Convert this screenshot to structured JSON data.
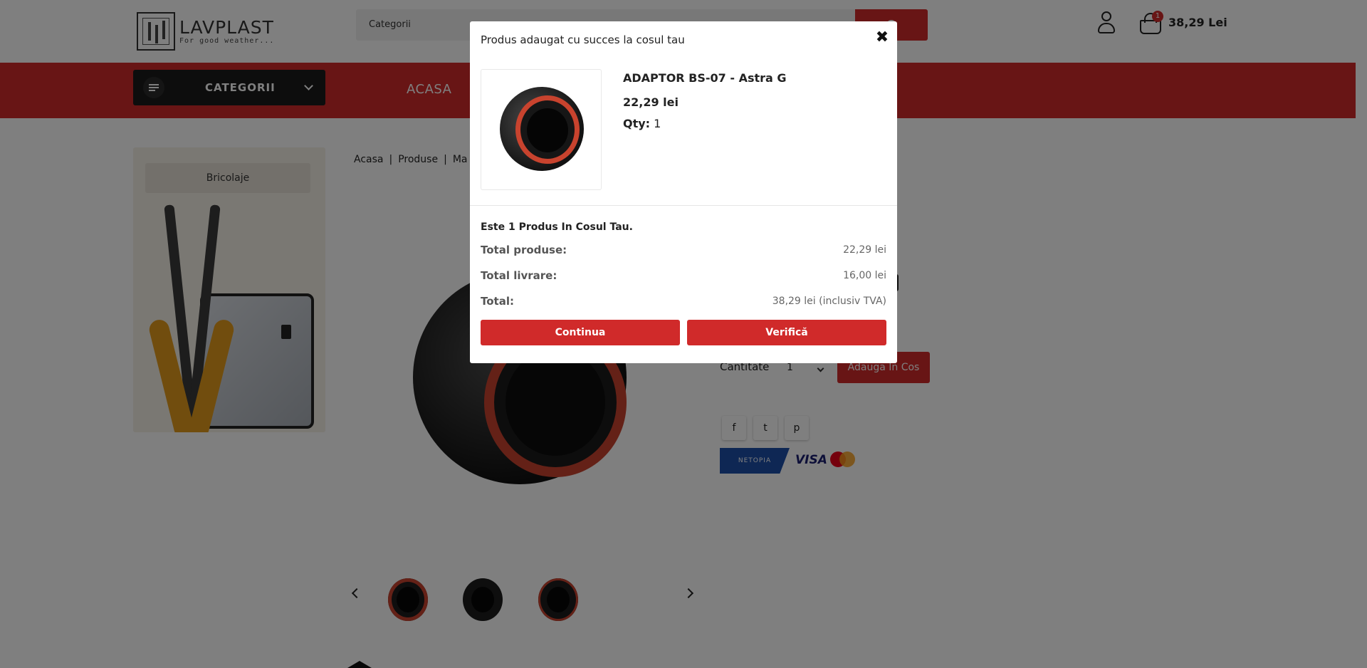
{
  "header": {
    "logo_name": "LAVPLAST",
    "logo_tagline": "For good weather...",
    "search_category": "Categorii",
    "cart_count": "1",
    "cart_total": "38,29 Lei"
  },
  "nav": {
    "categories_label": "CATEGORII",
    "home_link": "ACASA"
  },
  "sidebar": {
    "banner_label": "Bricolaje"
  },
  "breadcrumb": [
    "Acasa",
    "Produse",
    "Ma"
  ],
  "product": {
    "title_visible_tail": "G",
    "quantity_label": "Cantitate",
    "quantity_value": "1",
    "add_to_cart_label": "Adauga In Cos"
  },
  "social": {
    "facebook_icon": "f",
    "twitter_icon": "t",
    "pinterest_icon": "p"
  },
  "payments": {
    "netopia": "NETOPIA PAYMENTS",
    "visa": "VISA"
  },
  "modal": {
    "title": "Produs adaugat cu succes la cosul tau",
    "close_glyph": "✖",
    "product_name": "ADAPTOR BS-07 - Astra G",
    "product_price": "22,29 lei",
    "qty_label": "Qty:",
    "qty_value": "1",
    "cart_count_text": "Este 1 Produs In Cosul Tau.",
    "summary": [
      {
        "label": "Total produse:",
        "value": "22,29 lei"
      },
      {
        "label": "Total livrare:",
        "value": "16,00 lei"
      },
      {
        "label": "Total:",
        "value": "38,29 lei (inclusiv TVA)"
      }
    ],
    "continue_label": "Continua",
    "checkout_label": "Verifică"
  },
  "colors": {
    "brand_red": "#d02a2a",
    "dark": "#1b1b1b"
  }
}
